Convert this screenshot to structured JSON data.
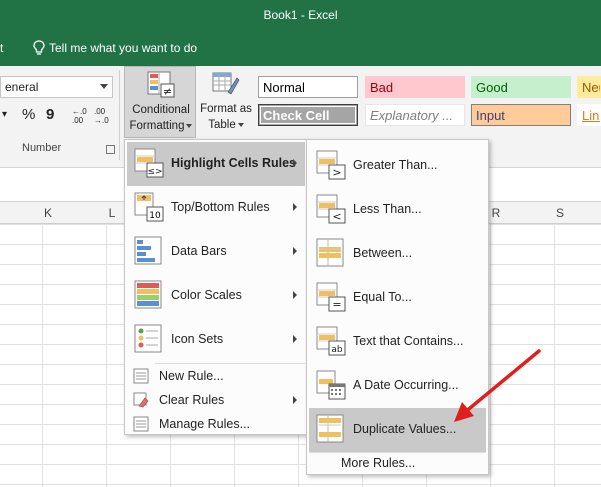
{
  "window": {
    "title": "Book1  -  Excel"
  },
  "tellbar": {
    "left_fragment": "t",
    "tell_me": "Tell me what you want to do"
  },
  "number_group": {
    "format_value": "eneral",
    "percent": "%",
    "comma": "9",
    "inc_decimal": "←.0\n.00",
    "dec_decimal": ".00\n→.0",
    "label": "Number"
  },
  "ribbon_buttons": {
    "conditional_formatting": [
      "Conditional",
      "Formatting"
    ],
    "format_as_table": [
      "Format as",
      "Table"
    ]
  },
  "cell_styles": [
    {
      "label": "Normal",
      "bg": "#ffffff",
      "fg": "#000000",
      "border": "#a0a0a0"
    },
    {
      "label": "Bad",
      "bg": "#ffc7ce",
      "fg": "#9c0006",
      "border": "#ffc7ce"
    },
    {
      "label": "Good",
      "bg": "#c6efce",
      "fg": "#006100",
      "border": "#c6efce"
    },
    {
      "label": "Neu",
      "bg": "#ffeb9c",
      "fg": "#9c5700",
      "border": "#ffeb9c"
    },
    {
      "label": "Check Cell",
      "bg": "#a5a5a5",
      "fg": "#ffffff",
      "border": "#3f3f3f"
    },
    {
      "label": "Explanatory ...",
      "bg": "#ffffff",
      "fg": "#7f7f7f",
      "border": "#e6e6e6"
    },
    {
      "label": "Input",
      "bg": "#ffcc99",
      "fg": "#3f3f76",
      "border": "#7f7f7f"
    },
    {
      "label": "Link",
      "bg": "#ffffff",
      "fg": "#ea7a17",
      "border": "#ffffff"
    }
  ],
  "columns": [
    "K",
    "L",
    "R",
    "S"
  ],
  "cf_menu": {
    "items": [
      {
        "label": "Highlight Cells Rules",
        "icon": "highlight-cells-icon",
        "submenu": true,
        "highlighted": true
      },
      {
        "label": "Top/Bottom Rules",
        "icon": "top-bottom-icon",
        "submenu": true,
        "highlighted": false
      },
      {
        "label": "Data Bars",
        "icon": "data-bars-icon",
        "submenu": true,
        "highlighted": false
      },
      {
        "label": "Color Scales",
        "icon": "color-scales-icon",
        "submenu": true,
        "highlighted": false
      },
      {
        "label": "Icon Sets",
        "icon": "icon-sets-icon",
        "submenu": true,
        "highlighted": false
      }
    ],
    "small_items": [
      {
        "label": "New Rule...",
        "icon": "new-rule-icon",
        "submenu": false
      },
      {
        "label": "Clear Rules",
        "icon": "clear-rules-icon",
        "submenu": true
      },
      {
        "label": "Manage Rules...",
        "icon": "manage-rules-icon",
        "submenu": false
      }
    ]
  },
  "highlight_submenu": {
    "items": [
      {
        "label": "Greater Than...",
        "icon": "greater-than-icon",
        "glyph": ">",
        "highlighted": false
      },
      {
        "label": "Less Than...",
        "icon": "less-than-icon",
        "glyph": "<",
        "highlighted": false
      },
      {
        "label": "Between...",
        "icon": "between-icon",
        "glyph": "",
        "highlighted": false
      },
      {
        "label": "Equal To...",
        "icon": "equal-to-icon",
        "glyph": "=",
        "highlighted": false
      },
      {
        "label": "Text that Contains...",
        "icon": "text-contains-icon",
        "glyph": "ab",
        "highlighted": false
      },
      {
        "label": "A Date Occurring...",
        "icon": "date-occurring-icon",
        "glyph": "",
        "highlighted": false
      },
      {
        "label": "Duplicate Values...",
        "icon": "duplicate-values-icon",
        "glyph": "",
        "highlighted": true
      }
    ],
    "more_rules": "More Rules..."
  },
  "colors": {
    "excel_green": "#217346",
    "arrow_red": "#e01e1e",
    "highlight": "#c9c9c9"
  }
}
